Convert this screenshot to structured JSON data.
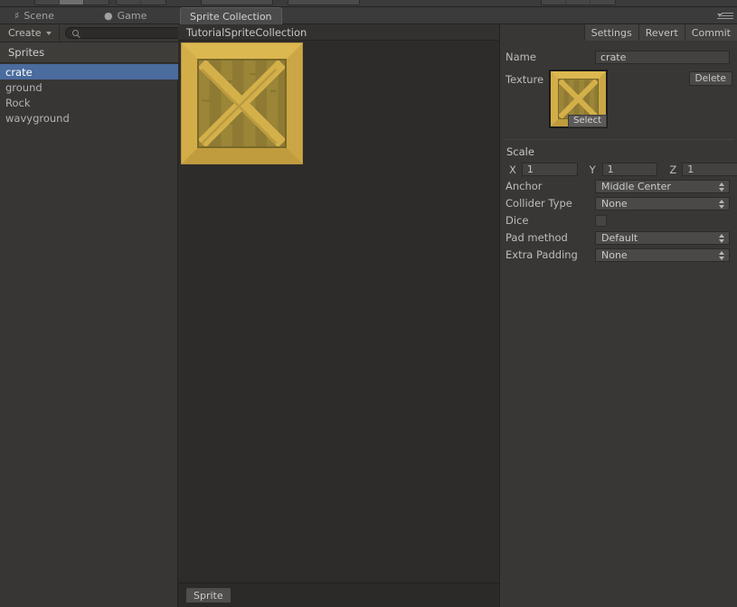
{
  "window": {
    "tabs": [
      {
        "label": "Scene",
        "icon": "grid-icon",
        "active": false
      },
      {
        "label": "Game",
        "icon": "gamepad-icon",
        "active": false
      },
      {
        "label": "Sprite Collection",
        "icon": "none",
        "active": true
      }
    ],
    "options_menu_icon": "hamburger-menu-icon"
  },
  "left_panel": {
    "create_label": "Create",
    "create_caret_icon": "caret-down-icon",
    "search_icon": "search-icon",
    "search_value": "",
    "search_placeholder": "",
    "header": "Sprites",
    "items": [
      {
        "label": "crate",
        "selected": true
      },
      {
        "label": "ground",
        "selected": false
      },
      {
        "label": "Rock",
        "selected": false
      },
      {
        "label": "wavyground",
        "selected": false
      }
    ]
  },
  "center": {
    "document_title": "TutorialSpriteCollection",
    "preview_alt": "crate-sprite-preview",
    "bottom_tab": "Sprite"
  },
  "inspector": {
    "toolbar": [
      {
        "label": "Settings"
      },
      {
        "label": "Revert"
      },
      {
        "label": "Commit"
      }
    ],
    "name_label": "Name",
    "name_value": "crate",
    "texture_label": "Texture",
    "texture_select_label": "Select",
    "texture_delete_label": "Delete",
    "scale_label": "Scale",
    "scale_axes": [
      {
        "axis": "X",
        "value": "1"
      },
      {
        "axis": "Y",
        "value": "1"
      },
      {
        "axis": "Z",
        "value": "1"
      }
    ],
    "fields": [
      {
        "label": "Anchor",
        "value": "Middle Center",
        "type": "dropdown"
      },
      {
        "label": "Collider Type",
        "value": "None",
        "type": "dropdown"
      },
      {
        "label": "Dice",
        "value": "",
        "type": "checkbox",
        "checked": false
      },
      {
        "label": "Pad method",
        "value": "Default",
        "type": "dropdown"
      },
      {
        "label": "Extra Padding",
        "value": "None",
        "type": "dropdown"
      }
    ]
  },
  "colors": {
    "panel_bg": "#383634",
    "canvas_bg": "#2e2c2b",
    "selection_blue": "#4a6c9e",
    "crate_gold": "#d8b24a",
    "crate_wood": "#a08a3c"
  }
}
